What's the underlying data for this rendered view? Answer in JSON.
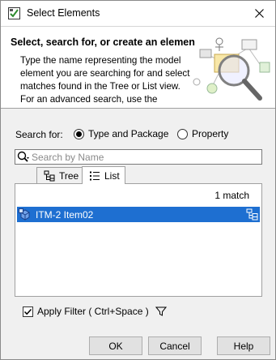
{
  "window": {
    "title": "Select Elements"
  },
  "header": {
    "title": "Select, search for, or create an elemen",
    "description": "Type the name representing the model element you are searching for and select matches found in the Tree or List view. For an advanced search, use the"
  },
  "search_for": {
    "label": "Search for:",
    "options": [
      {
        "label": "Type and Package",
        "selected": true
      },
      {
        "label": "Property",
        "selected": false
      }
    ]
  },
  "search": {
    "placeholder": "Search by Name",
    "value": ""
  },
  "tabs": [
    {
      "label": "Tree",
      "active": false
    },
    {
      "label": "List",
      "active": true
    }
  ],
  "results": {
    "match_count": "1 match",
    "items": [
      {
        "label": "ITM-2 Item02",
        "selected": true
      }
    ]
  },
  "filter": {
    "label": "Apply Filter ( Ctrl+Space )",
    "checked": true
  },
  "buttons": {
    "ok": "OK",
    "cancel": "Cancel",
    "help": "Help"
  },
  "colors": {
    "selection": "#1e6fd1",
    "dialog_bg": "#f0f0f0"
  }
}
